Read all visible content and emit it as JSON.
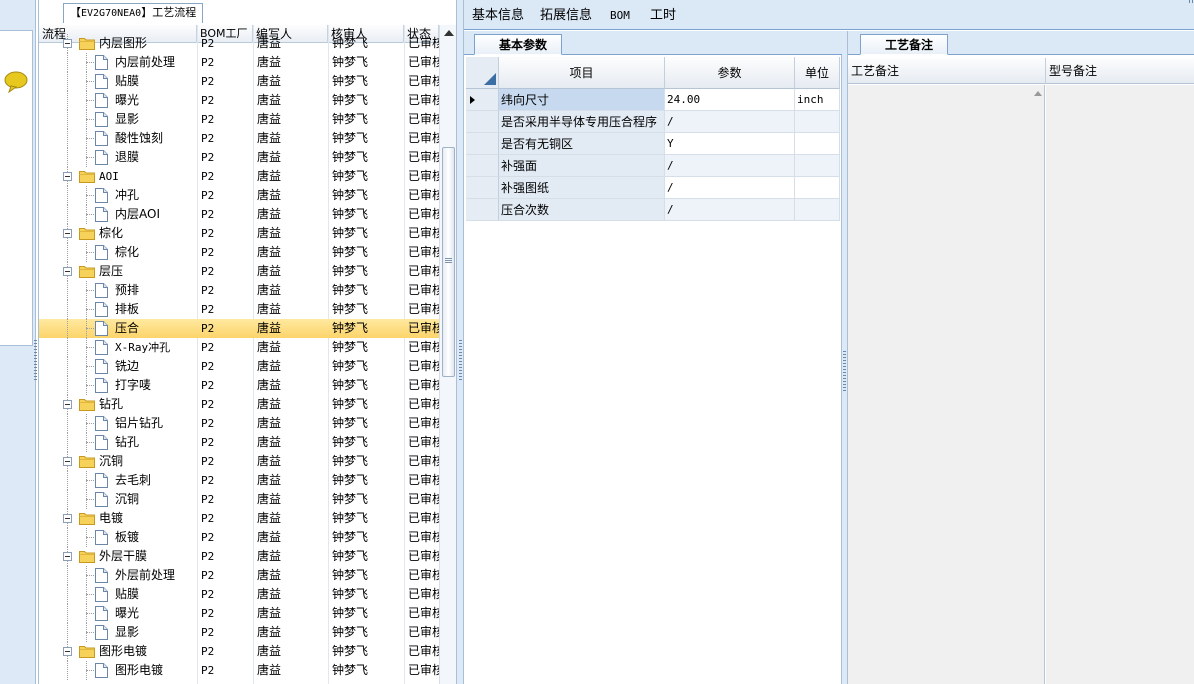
{
  "colors": {
    "selection_row": "#fcd46a",
    "active_tab": "#2f66b5",
    "panel_bg": "#dbe8f6"
  },
  "tree_panel": {
    "bom_code": "EV2G70NEA0",
    "title_suffix": "工艺流程",
    "columns": [
      "流程",
      "BOM工厂",
      "编写人",
      "核审人",
      "状态"
    ],
    "rows": [
      {
        "level": 1,
        "type": "folder",
        "label": "内层图形",
        "factory": "P2",
        "writer": "唐益",
        "checker": "钟梦飞",
        "status": "已审核"
      },
      {
        "level": 2,
        "type": "file",
        "label": "内层前处理",
        "factory": "P2",
        "writer": "唐益",
        "checker": "钟梦飞",
        "status": "已审核"
      },
      {
        "level": 2,
        "type": "file",
        "label": "贴膜",
        "factory": "P2",
        "writer": "唐益",
        "checker": "钟梦飞",
        "status": "已审核"
      },
      {
        "level": 2,
        "type": "file",
        "label": "曝光",
        "factory": "P2",
        "writer": "唐益",
        "checker": "钟梦飞",
        "status": "已审核"
      },
      {
        "level": 2,
        "type": "file",
        "label": "显影",
        "factory": "P2",
        "writer": "唐益",
        "checker": "钟梦飞",
        "status": "已审核"
      },
      {
        "level": 2,
        "type": "file",
        "label": "酸性蚀刻",
        "factory": "P2",
        "writer": "唐益",
        "checker": "钟梦飞",
        "status": "已审核"
      },
      {
        "level": 2,
        "type": "file",
        "label": "退膜",
        "factory": "P2",
        "writer": "唐益",
        "checker": "钟梦飞",
        "status": "已审核"
      },
      {
        "level": 1,
        "type": "folder",
        "label": "AOI",
        "factory": "P2",
        "writer": "唐益",
        "checker": "钟梦飞",
        "status": "已审核"
      },
      {
        "level": 2,
        "type": "file",
        "label": "冲孔",
        "factory": "P2",
        "writer": "唐益",
        "checker": "钟梦飞",
        "status": "已审核"
      },
      {
        "level": 2,
        "type": "file",
        "label": "内层AOI",
        "factory": "P2",
        "writer": "唐益",
        "checker": "钟梦飞",
        "status": "已审核"
      },
      {
        "level": 1,
        "type": "folder",
        "label": "棕化",
        "factory": "P2",
        "writer": "唐益",
        "checker": "钟梦飞",
        "status": "已审核"
      },
      {
        "level": 2,
        "type": "file",
        "label": "棕化",
        "factory": "P2",
        "writer": "唐益",
        "checker": "钟梦飞",
        "status": "已审核"
      },
      {
        "level": 1,
        "type": "folder",
        "label": "层压",
        "factory": "P2",
        "writer": "唐益",
        "checker": "钟梦飞",
        "status": "已审核"
      },
      {
        "level": 2,
        "type": "file",
        "label": "预排",
        "factory": "P2",
        "writer": "唐益",
        "checker": "钟梦飞",
        "status": "已审核"
      },
      {
        "level": 2,
        "type": "file",
        "label": "排板",
        "factory": "P2",
        "writer": "唐益",
        "checker": "钟梦飞",
        "status": "已审核"
      },
      {
        "level": 2,
        "type": "file",
        "label": "压合",
        "factory": "P2",
        "writer": "唐益",
        "checker": "钟梦飞",
        "status": "已审核",
        "selected": true
      },
      {
        "level": 2,
        "type": "file",
        "label": "X-Ray冲孔",
        "factory": "P2",
        "writer": "唐益",
        "checker": "钟梦飞",
        "status": "已审核"
      },
      {
        "level": 2,
        "type": "file",
        "label": "铣边",
        "factory": "P2",
        "writer": "唐益",
        "checker": "钟梦飞",
        "status": "已审核"
      },
      {
        "level": 2,
        "type": "file",
        "label": "打字唛",
        "factory": "P2",
        "writer": "唐益",
        "checker": "钟梦飞",
        "status": "已审核"
      },
      {
        "level": 1,
        "type": "folder",
        "label": "钻孔",
        "factory": "P2",
        "writer": "唐益",
        "checker": "钟梦飞",
        "status": "已审核"
      },
      {
        "level": 2,
        "type": "file",
        "label": "铝片钻孔",
        "factory": "P2",
        "writer": "唐益",
        "checker": "钟梦飞",
        "status": "已审核"
      },
      {
        "level": 2,
        "type": "file",
        "label": "钻孔",
        "factory": "P2",
        "writer": "唐益",
        "checker": "钟梦飞",
        "status": "已审核"
      },
      {
        "level": 1,
        "type": "folder",
        "label": "沉铜",
        "factory": "P2",
        "writer": "唐益",
        "checker": "钟梦飞",
        "status": "已审核"
      },
      {
        "level": 2,
        "type": "file",
        "label": "去毛刺",
        "factory": "P2",
        "writer": "唐益",
        "checker": "钟梦飞",
        "status": "已审核"
      },
      {
        "level": 2,
        "type": "file",
        "label": "沉铜",
        "factory": "P2",
        "writer": "唐益",
        "checker": "钟梦飞",
        "status": "已审核"
      },
      {
        "level": 1,
        "type": "folder",
        "label": "电镀",
        "factory": "P2",
        "writer": "唐益",
        "checker": "钟梦飞",
        "status": "已审核"
      },
      {
        "level": 2,
        "type": "file",
        "label": "板镀",
        "factory": "P2",
        "writer": "唐益",
        "checker": "钟梦飞",
        "status": "已审核"
      },
      {
        "level": 1,
        "type": "folder",
        "label": "外层干膜",
        "factory": "P2",
        "writer": "唐益",
        "checker": "钟梦飞",
        "status": "已审核"
      },
      {
        "level": 2,
        "type": "file",
        "label": "外层前处理",
        "factory": "P2",
        "writer": "唐益",
        "checker": "钟梦飞",
        "status": "已审核"
      },
      {
        "level": 2,
        "type": "file",
        "label": "贴膜",
        "factory": "P2",
        "writer": "唐益",
        "checker": "钟梦飞",
        "status": "已审核"
      },
      {
        "level": 2,
        "type": "file",
        "label": "曝光",
        "factory": "P2",
        "writer": "唐益",
        "checker": "钟梦飞",
        "status": "已审核"
      },
      {
        "level": 2,
        "type": "file",
        "label": "显影",
        "factory": "P2",
        "writer": "唐益",
        "checker": "钟梦飞",
        "status": "已审核"
      },
      {
        "level": 1,
        "type": "folder",
        "label": "图形电镀",
        "factory": "P2",
        "writer": "唐益",
        "checker": "钟梦飞",
        "status": "已审核"
      },
      {
        "level": 2,
        "type": "file",
        "label": "图形电镀",
        "factory": "P2",
        "writer": "唐益",
        "checker": "钟梦飞",
        "status": "已审核"
      }
    ]
  },
  "main_tabs": [
    {
      "label": "基本信息",
      "active": true
    },
    {
      "label": "拓展信息",
      "active": false
    },
    {
      "label": "BOM",
      "active": false
    },
    {
      "label": "工时",
      "active": false
    }
  ],
  "params": {
    "tab_label": "基本参数",
    "columns": [
      "项目",
      "参数",
      "单位"
    ],
    "rows": [
      {
        "item": "纬向尺寸",
        "value": "24.00",
        "unit": "inch",
        "current": true
      },
      {
        "item": "是否采用半导体专用压合程序",
        "value": "/",
        "unit": ""
      },
      {
        "item": "是否有无铜区",
        "value": "Y",
        "unit": ""
      },
      {
        "item": "补强面",
        "value": "/",
        "unit": ""
      },
      {
        "item": "补强图纸",
        "value": "/",
        "unit": ""
      },
      {
        "item": "压合次数",
        "value": "/",
        "unit": ""
      }
    ]
  },
  "notes": {
    "tab_label": "工艺备注",
    "columns": [
      "工艺备注",
      "型号备注"
    ]
  }
}
